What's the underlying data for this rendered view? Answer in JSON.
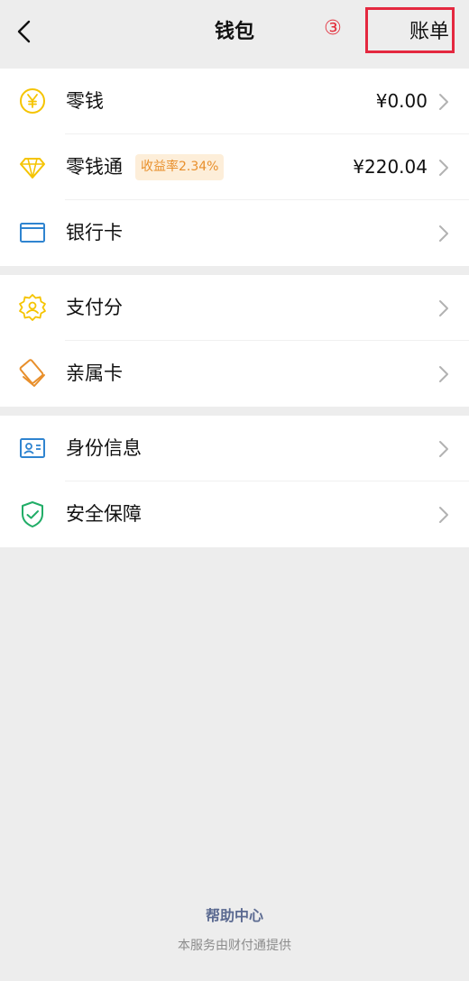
{
  "header": {
    "title": "钱包",
    "step_marker": "③",
    "bill_label": "账单"
  },
  "groups": [
    {
      "items": [
        {
          "label": "零钱",
          "icon": "coin-yen-icon",
          "amount": "¥0.00"
        },
        {
          "label": "零钱通",
          "icon": "diamond-icon",
          "badge": "收益率2.34%",
          "amount": "¥220.04"
        },
        {
          "label": "银行卡",
          "icon": "bank-card-icon"
        }
      ]
    },
    {
      "items": [
        {
          "label": "支付分",
          "icon": "credit-score-badge-icon"
        },
        {
          "label": "亲属卡",
          "icon": "family-card-icon"
        }
      ]
    },
    {
      "items": [
        {
          "label": "身份信息",
          "icon": "id-card-icon"
        },
        {
          "label": "安全保障",
          "icon": "shield-check-icon"
        }
      ]
    }
  ],
  "footer": {
    "help_label": "帮助中心",
    "provider_note": "本服务由财付通提供"
  },
  "colors": {
    "yellow": "#f5c400",
    "orange": "#e88f2b",
    "blue": "#2f84d0",
    "green": "#21ad67",
    "highlight_red": "#e4283f"
  }
}
